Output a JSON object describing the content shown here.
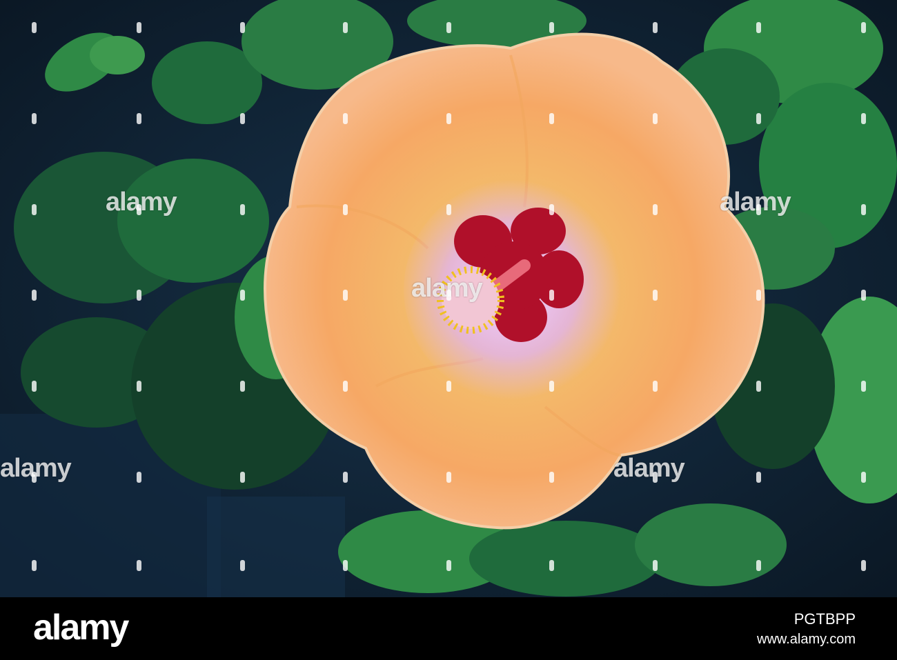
{
  "photo": {
    "subject_icon": "hibiscus-flower",
    "colors": {
      "background": "#0f1e2c",
      "leaf_dark": "#14402a",
      "leaf_mid": "#1f6b3c",
      "leaf_light": "#3e9a4f",
      "petal_outer": "#f6a865",
      "petal_inner": "#f2c06c",
      "center_halo": "#e6b7e6",
      "center_eye": "#b0102a",
      "stamen": "#f0c020"
    }
  },
  "watermark": {
    "text": "alamy"
  },
  "footer": {
    "logo": "alamy",
    "image_id": "PGTBPP",
    "url": "www.alamy.com"
  }
}
